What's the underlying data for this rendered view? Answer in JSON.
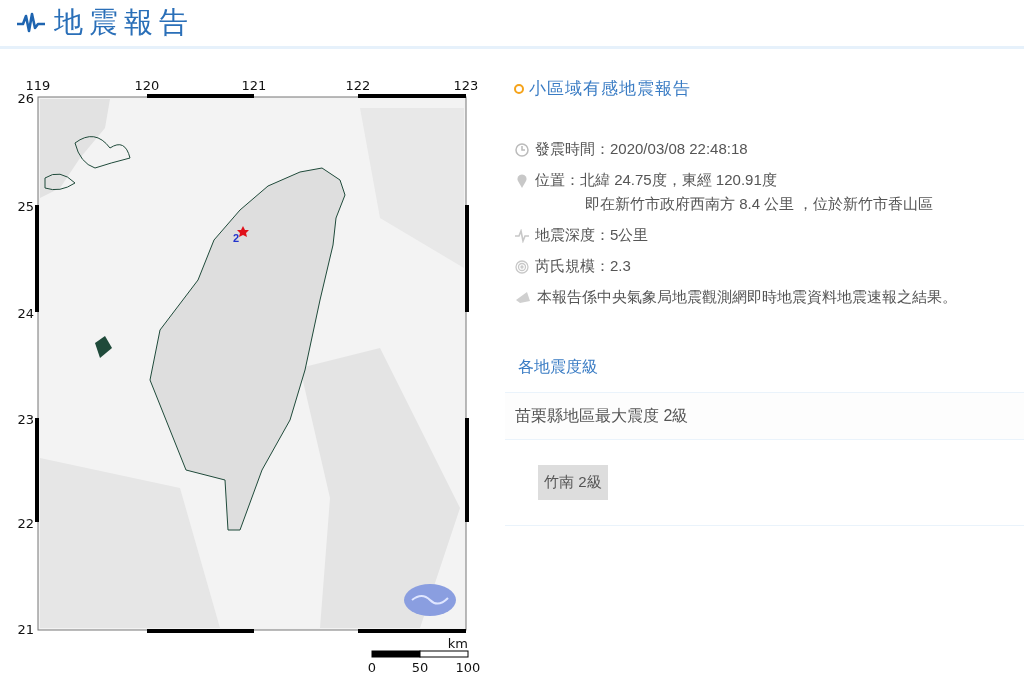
{
  "header": {
    "title": "地震報告"
  },
  "map": {
    "lon_ticks": [
      "119",
      "120",
      "121",
      "122",
      "123"
    ],
    "lat_ticks": [
      "26",
      "25",
      "24",
      "23",
      "22",
      "21"
    ],
    "epicenter_label": "2",
    "scale": {
      "unit": "km",
      "labels": [
        "0",
        "50",
        "100"
      ]
    }
  },
  "report": {
    "title": "小區域有感地震報告",
    "details": [
      {
        "kind": "time",
        "text": "發震時間：2020/03/08 22:48:18"
      },
      {
        "kind": "location",
        "text": "位置：北緯 24.75度，東經 120.91度",
        "subtext": "即在新竹市政府西南方 8.4 公里 ，位於新竹市香山區"
      },
      {
        "kind": "depth",
        "text": "地震深度：5公里"
      },
      {
        "kind": "magnitude",
        "text": "芮氏規模：2.3"
      },
      {
        "kind": "note",
        "text": "本報告係中央氣象局地震觀測網即時地震資料地震速報之結果。"
      }
    ]
  },
  "intensity": {
    "heading": "各地震度級",
    "summary": "苗栗縣地區最大震度 2級",
    "stations": [
      "竹南 2級"
    ]
  }
}
